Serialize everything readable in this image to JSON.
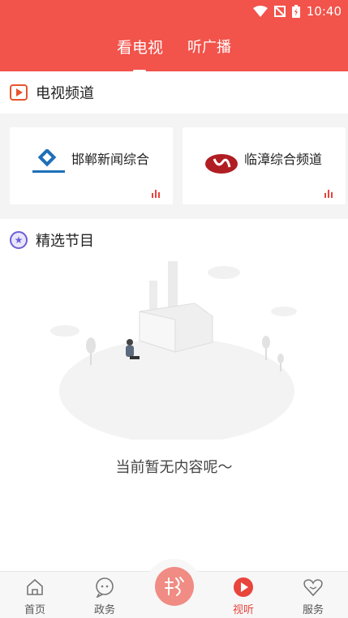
{
  "status": {
    "time": "10:40"
  },
  "tabs": [
    {
      "label": "看电视",
      "active": true
    },
    {
      "label": "听广播",
      "active": false
    }
  ],
  "tv_section": {
    "title": "电视频道",
    "icon": "tv-play-icon"
  },
  "channels": [
    {
      "name": "邯郸新闻综合",
      "logo": "handan-news-logo"
    },
    {
      "name": "临漳综合频道",
      "logo": "linzhang-logo"
    }
  ],
  "featured_section": {
    "title": "精选节目",
    "icon": "star-badge-icon"
  },
  "empty_state": {
    "message": "当前暂无内容呢～"
  },
  "bottom_nav": [
    {
      "label": "首页",
      "icon": "home-icon",
      "active": false
    },
    {
      "label": "政务",
      "icon": "chat-icon",
      "active": false
    },
    {
      "label": "视听",
      "icon": "play-icon",
      "active": true
    },
    {
      "label": "服务",
      "icon": "heart-icon",
      "active": false
    }
  ],
  "colors": {
    "brand_red": "#f2534b",
    "active_red": "#e8453c",
    "accent_purple": "#6b5fd6"
  }
}
